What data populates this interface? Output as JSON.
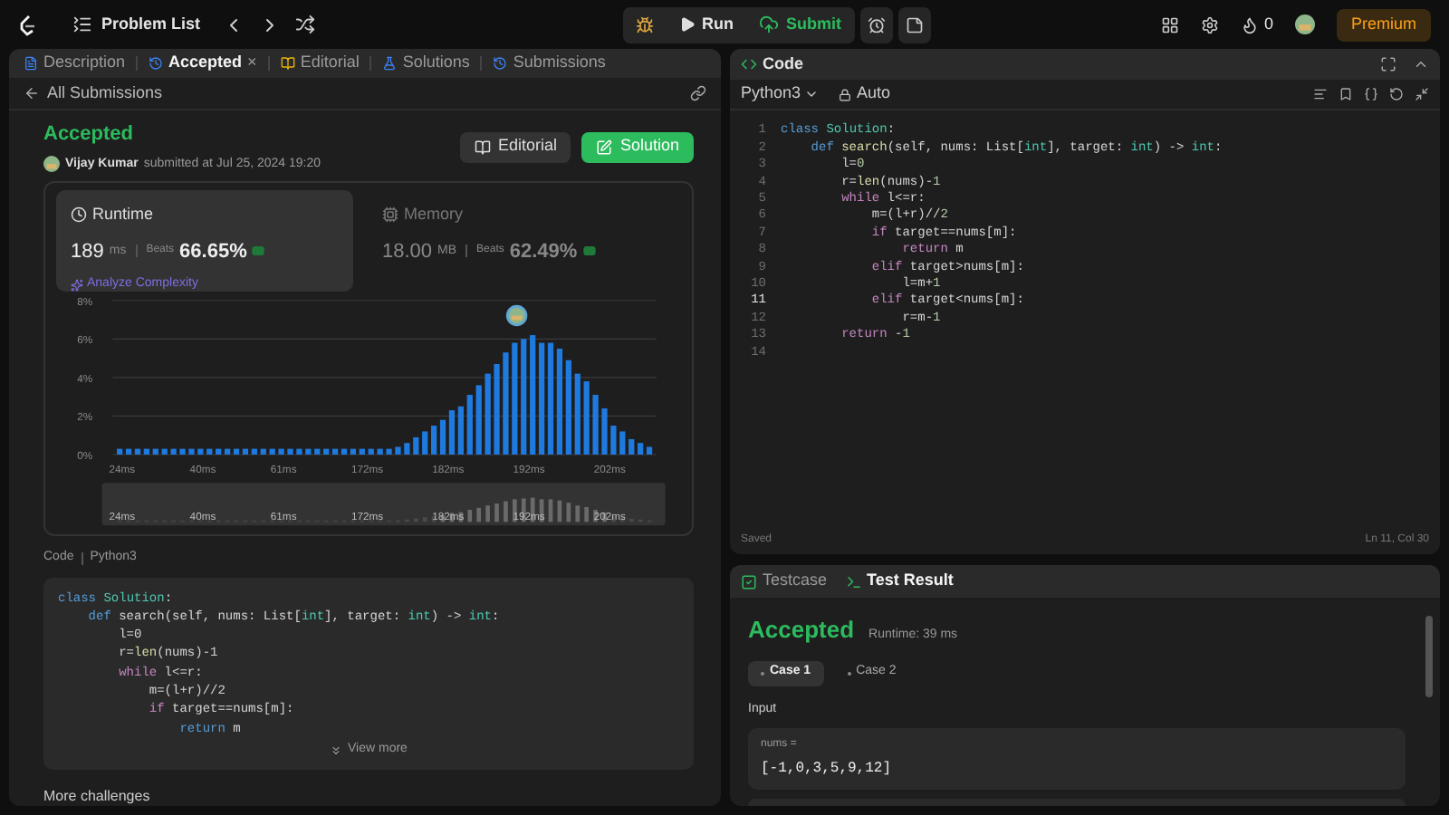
{
  "topbar": {
    "title": "Problem List",
    "run": "Run",
    "submit": "Submit",
    "streak": "0",
    "premium": "Premium"
  },
  "tabs": [
    {
      "kind": "description",
      "label": "Description",
      "selected": false
    },
    {
      "kind": "result",
      "label": "Accepted",
      "selected": true,
      "close": "×"
    },
    {
      "kind": "editorial",
      "label": "Editorial",
      "selected": false
    },
    {
      "kind": "solutions",
      "label": "Solutions",
      "selected": false
    },
    {
      "kind": "submissions",
      "label": "Submissions",
      "selected": false
    }
  ],
  "back": "All Submissions",
  "submission": {
    "status": "Accepted",
    "author": "Vijay Kumar",
    "meta": "submitted at Jul 25, 2024 19:20",
    "editorial_button": "Editorial",
    "solution_button": "Solution"
  },
  "stats": [
    {
      "kind": "runtime",
      "title": "Runtime",
      "value": "189",
      "unit": "ms",
      "beats_label": "Beats",
      "beats": "66.65%",
      "selected": true,
      "link": "Analyze Complexity"
    },
    {
      "kind": "memory",
      "title": "Memory",
      "value": "18.00",
      "unit": "MB",
      "beats_label": "Beats",
      "beats": "62.49%",
      "selected": false
    }
  ],
  "chart_data": {
    "type": "bar",
    "categories": [
      "24ms",
      null,
      null,
      null,
      null,
      null,
      null,
      null,
      null,
      "40ms",
      null,
      null,
      null,
      null,
      null,
      null,
      null,
      null,
      "61ms",
      null,
      null,
      null,
      null,
      null,
      null,
      null,
      null,
      "172ms",
      null,
      null,
      null,
      null,
      null,
      null,
      null,
      null,
      "182ms",
      null,
      null,
      null,
      null,
      null,
      null,
      null,
      null,
      "192ms",
      null,
      null,
      null,
      null,
      null,
      null,
      null,
      null,
      "202ms",
      null,
      null,
      null,
      null,
      null
    ],
    "values": [
      0.3,
      0.3,
      0.3,
      0.3,
      0.3,
      0.3,
      0.3,
      0.3,
      0.3,
      0.3,
      0.3,
      0.3,
      0.3,
      0.3,
      0.3,
      0.3,
      0.3,
      0.3,
      0.3,
      0.3,
      0.3,
      0.3,
      0.3,
      0.3,
      0.3,
      0.3,
      0.3,
      0.3,
      0.3,
      0.3,
      0.3,
      0.4,
      0.6,
      0.9,
      1.2,
      1.5,
      1.8,
      2.3,
      2.5,
      3.1,
      3.6,
      4.2,
      4.7,
      5.3,
      5.8,
      6.0,
      6.2,
      5.8,
      5.8,
      5.5,
      4.9,
      4.2,
      3.8,
      3.1,
      2.4,
      1.5,
      1.2,
      0.8,
      0.6,
      0.4
    ],
    "ylim": [
      0,
      8
    ],
    "yticks": [
      {
        "value": 0,
        "label": "0%"
      },
      {
        "value": 2,
        "label": "2%"
      },
      {
        "value": 4,
        "label": "4%"
      },
      {
        "value": 6,
        "label": "6%"
      },
      {
        "value": 8,
        "label": "8%"
      }
    ],
    "grid": true
  },
  "range_labels": [
    "24ms",
    "40ms",
    "61ms",
    "172ms",
    "182ms",
    "192ms",
    "202ms"
  ],
  "code_preview": {
    "title": "Code",
    "language": "Python3",
    "view_more": "View more",
    "lines": [
      [
        {
          "kind": "kw",
          "text": "class "
        },
        {
          "kind": "cls",
          "text": "Solution"
        },
        {
          "kind": "p",
          "text": ":"
        }
      ],
      [
        {
          "kind": "kw",
          "text": "    def "
        },
        {
          "kind": "p",
          "text": "search(self, nums: List["
        },
        {
          "kind": "cls",
          "text": "int"
        },
        {
          "kind": "p",
          "text": "], target: "
        },
        {
          "kind": "cls",
          "text": "int"
        },
        {
          "kind": "p",
          "text": ") -> "
        },
        {
          "kind": "cls",
          "text": "int"
        },
        {
          "kind": "p",
          "text": ":"
        }
      ],
      [
        {
          "kind": "p",
          "text": "        l=0"
        }
      ],
      [
        {
          "kind": "p",
          "text": "        r="
        },
        {
          "kind": "fn",
          "text": "len"
        },
        {
          "kind": "p",
          "text": "(nums)-1"
        }
      ],
      [
        {
          "kind": "ctl",
          "text": "        while"
        },
        {
          "kind": "p",
          "text": " l<=r:"
        }
      ],
      [
        {
          "kind": "p",
          "text": "            m=(l+r)//2"
        }
      ],
      [
        {
          "kind": "ctl",
          "text": "            if"
        },
        {
          "kind": "p",
          "text": " target==nums[m]:"
        }
      ],
      [
        {
          "kind": "kw",
          "text": "                return"
        },
        {
          "kind": "p",
          "text": " m"
        }
      ]
    ]
  },
  "more": "More challenges",
  "editor": {
    "title": "Code",
    "language": "Python3",
    "mode": "Auto",
    "status": "Saved",
    "position": "Ln 11, Col 30",
    "lines": [
      {
        "n": "1",
        "current": false,
        "tokens": [
          {
            "kind": "kw",
            "text": "class "
          },
          {
            "kind": "cls",
            "text": "Solution"
          },
          {
            "kind": "p",
            "text": ":"
          }
        ]
      },
      {
        "n": "2",
        "current": false,
        "tokens": [
          {
            "kind": "kw",
            "text": "    def "
          },
          {
            "kind": "fn",
            "text": "search"
          },
          {
            "kind": "p",
            "text": "(self, nums: List["
          },
          {
            "kind": "cls",
            "text": "int"
          },
          {
            "kind": "p",
            "text": "], target: "
          },
          {
            "kind": "cls",
            "text": "int"
          },
          {
            "kind": "p",
            "text": ") -> "
          },
          {
            "kind": "cls",
            "text": "int"
          },
          {
            "kind": "p",
            "text": ":"
          }
        ]
      },
      {
        "n": "3",
        "current": false,
        "tokens": [
          {
            "kind": "p",
            "text": "        l="
          },
          {
            "kind": "num",
            "text": "0"
          }
        ]
      },
      {
        "n": "4",
        "current": false,
        "tokens": [
          {
            "kind": "p",
            "text": "        r="
          },
          {
            "kind": "fn",
            "text": "len"
          },
          {
            "kind": "p",
            "text": "(nums)-"
          },
          {
            "kind": "num",
            "text": "1"
          }
        ]
      },
      {
        "n": "5",
        "current": false,
        "tokens": [
          {
            "kind": "ctl",
            "text": "        while"
          },
          {
            "kind": "p",
            "text": " l<=r:"
          }
        ]
      },
      {
        "n": "6",
        "current": false,
        "tokens": [
          {
            "kind": "p",
            "text": "            m=(l+r)//"
          },
          {
            "kind": "num",
            "text": "2"
          }
        ]
      },
      {
        "n": "7",
        "current": false,
        "tokens": [
          {
            "kind": "ctl",
            "text": "            if"
          },
          {
            "kind": "p",
            "text": " target==nums[m]:"
          }
        ]
      },
      {
        "n": "8",
        "current": false,
        "tokens": [
          {
            "kind": "ctl",
            "text": "                return"
          },
          {
            "kind": "p",
            "text": " m"
          }
        ]
      },
      {
        "n": "9",
        "current": false,
        "tokens": [
          {
            "kind": "ctl",
            "text": "            elif"
          },
          {
            "kind": "p",
            "text": " target>nums[m]:"
          }
        ]
      },
      {
        "n": "10",
        "current": false,
        "tokens": [
          {
            "kind": "p",
            "text": "                l=m+"
          },
          {
            "kind": "num",
            "text": "1"
          }
        ]
      },
      {
        "n": "11",
        "current": true,
        "tokens": [
          {
            "kind": "ctl",
            "text": "            elif"
          },
          {
            "kind": "p",
            "text": " target<nums[m]:"
          }
        ]
      },
      {
        "n": "12",
        "current": false,
        "tokens": [
          {
            "kind": "p",
            "text": "                r=m-"
          },
          {
            "kind": "num",
            "text": "1"
          }
        ]
      },
      {
        "n": "13",
        "current": false,
        "tokens": [
          {
            "kind": "ctl",
            "text": "        return"
          },
          {
            "kind": "p",
            "text": " -"
          },
          {
            "kind": "num",
            "text": "1"
          }
        ]
      },
      {
        "n": "14",
        "current": false
      }
    ]
  },
  "test_tabs": [
    {
      "kind": "testcase",
      "label": "Testcase",
      "selected": false
    },
    {
      "kind": "result",
      "label": "Test Result",
      "selected": true
    }
  ],
  "result": {
    "status": "Accepted",
    "runtime": "Runtime: 39 ms",
    "cases": [
      {
        "label": "Case 1",
        "selected": true
      },
      {
        "label": "Case 2",
        "selected": false
      }
    ],
    "input_label": "Input",
    "inputs": [
      {
        "name": "nums =",
        "value": "[-1,0,3,5,9,12]"
      }
    ]
  }
}
